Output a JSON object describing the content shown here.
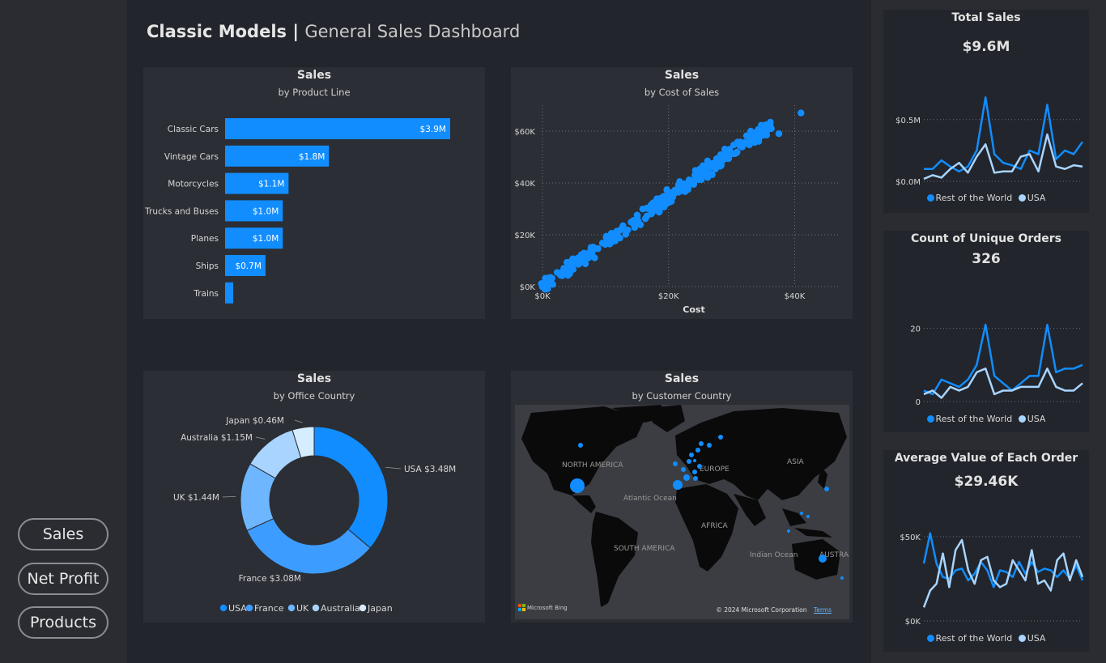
{
  "nav": {
    "buttons": [
      "Sales",
      "Net Profit",
      "Products"
    ]
  },
  "header": {
    "title_bold": "Classic Models",
    "separator": " | ",
    "title_light": "General Sales Dashboard"
  },
  "colors": {
    "primary": "#118dff",
    "mid": "#4aa3ff",
    "light": "#a8d4ff",
    "lightest": "#d6ecff",
    "bg": "#22252b",
    "card": "#2b2e34"
  },
  "product_line": {
    "title": "Sales",
    "subtitle": "by Product Line",
    "chart_data": {
      "type": "bar",
      "categories": [
        "Classic Cars",
        "Vintage Cars",
        "Motorcycles",
        "Trucks and Buses",
        "Planes",
        "Ships",
        "Trains"
      ],
      "values": [
        3.9,
        1.8,
        1.1,
        1.0,
        1.0,
        0.7,
        0.1
      ],
      "labels": [
        "$3.9M",
        "$1.8M",
        "$1.1M",
        "$1.0M",
        "$1.0M",
        "$0.7M",
        ""
      ],
      "unit": "$M"
    }
  },
  "cost_scatter": {
    "title": "Sales",
    "subtitle": "by Cost of Sales",
    "chart_data": {
      "type": "scatter",
      "xlabel": "Cost",
      "x_ticks": [
        "$0K",
        "$20K",
        "$40K"
      ],
      "y_ticks": [
        "$0K",
        "$20K",
        "$40K",
        "$60K"
      ],
      "xlim": [
        0,
        47
      ],
      "ylim": [
        0,
        70
      ],
      "trend": {
        "x": [
          0,
          36
        ],
        "y": [
          0,
          62
        ]
      },
      "outliers": [
        {
          "x": 41,
          "y": 67
        },
        {
          "x": 36.3,
          "y": 61
        },
        {
          "x": 37.5,
          "y": 59
        }
      ]
    }
  },
  "office_country": {
    "title": "Sales",
    "subtitle": "by Office Country",
    "chart_data": {
      "type": "pie",
      "categories": [
        "USA",
        "France",
        "UK",
        "Australia",
        "Japan"
      ],
      "values": [
        3.48,
        3.08,
        1.44,
        1.15,
        0.46
      ],
      "labels": [
        "USA $3.48M",
        "France $3.08M",
        "UK $1.44M",
        "Australia $1.15M",
        "Japan $0.46M"
      ],
      "colors": [
        "#118dff",
        "#3d9cff",
        "#6eb6ff",
        "#a8d4ff",
        "#d6ecff"
      ]
    }
  },
  "customer_country": {
    "title": "Sales",
    "subtitle": "by Customer Country",
    "map_labels": {
      "north_america": "NORTH AMERICA",
      "europe": "EUROPE",
      "asia": "ASIA",
      "atlantic": "Atlantic Ocean",
      "africa": "AFRICA",
      "south_america": "SOUTH AMERICA",
      "indian": "Indian Ocean",
      "australia": "AUSTRAL"
    },
    "bing": "Microsoft Bing",
    "copyright": "© 2024 Microsoft Corporation",
    "terms": "Terms"
  },
  "kpi_total_sales": {
    "title": "Total Sales",
    "value": "$9.6M",
    "chart_data": {
      "type": "line",
      "y_ticks": [
        "$0.5M",
        "$0.0M"
      ],
      "ylim": [
        0,
        0.8
      ],
      "series": [
        {
          "name": "Rest of the World",
          "values": [
            0.1,
            0.1,
            0.17,
            0.12,
            0.08,
            0.12,
            0.25,
            0.68,
            0.22,
            0.15,
            0.13,
            0.1,
            0.25,
            0.22,
            0.62,
            0.18,
            0.25,
            0.22,
            0.32
          ]
        },
        {
          "name": "USA",
          "values": [
            0.02,
            0.05,
            0.03,
            0.1,
            0.15,
            0.07,
            0.2,
            0.3,
            0.07,
            0.08,
            0.08,
            0.2,
            0.22,
            0.08,
            0.38,
            0.12,
            0.1,
            0.13,
            0.12
          ]
        }
      ]
    }
  },
  "kpi_orders": {
    "title": "Count of Unique Orders",
    "value": "326",
    "chart_data": {
      "type": "line",
      "y_ticks": [
        "20",
        "0"
      ],
      "ylim": [
        0,
        25
      ],
      "series": [
        {
          "name": "Rest of the World",
          "values": [
            3,
            2,
            6,
            5,
            4,
            6,
            10,
            21,
            7,
            5,
            3,
            5,
            7,
            7,
            21,
            8,
            9,
            9,
            10
          ]
        },
        {
          "name": "USA",
          "values": [
            2,
            3,
            1,
            4,
            3,
            4,
            8,
            9,
            2,
            3,
            3,
            4,
            4,
            4,
            9,
            4,
            3,
            3,
            5
          ]
        }
      ]
    }
  },
  "kpi_avg_order": {
    "title": "Average Value of Each Order",
    "value": "$29.46K",
    "chart_data": {
      "type": "line",
      "y_ticks": [
        "$50K",
        "$0K"
      ],
      "ylim": [
        0,
        60
      ],
      "series": [
        {
          "name": "Rest of the World",
          "values": [
            34,
            52,
            34,
            26,
            25,
            30,
            31,
            24,
            28,
            35,
            30,
            20,
            30,
            29,
            26,
            35,
            28,
            35,
            29,
            31,
            30,
            26,
            30,
            25,
            33,
            24
          ]
        },
        {
          "name": "USA",
          "values": [
            8,
            18,
            22,
            40,
            20,
            42,
            48,
            30,
            22,
            36,
            38,
            24,
            20,
            22,
            36,
            30,
            24,
            42,
            22,
            24,
            18,
            36,
            40,
            24,
            36,
            26
          ]
        }
      ]
    }
  },
  "legend_two": {
    "a": "Rest of the World",
    "b": "USA"
  }
}
